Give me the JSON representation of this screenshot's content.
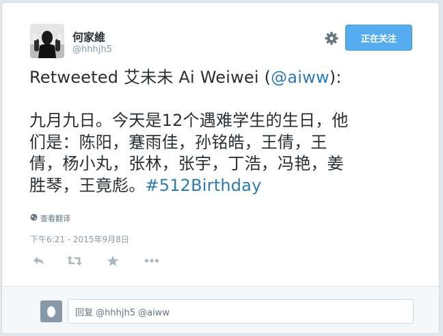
{
  "author": {
    "display_name": "何家維",
    "screen_name": "@hhhjh5"
  },
  "header": {
    "follow_button_label": "正在关注"
  },
  "tweet": {
    "retweet_prefix": "Retweeted 艾未未  Ai Weiwei (",
    "mention": "@aiww",
    "retweet_suffix": "):",
    "line1": "九月九日。今天是12个遇难学生的生日，他",
    "line2": "们是：陈阳，蹇雨佳，孙铭皓，王倩，王",
    "line3": "倩，杨小丸，张林，张宇，丁浩，冯艳，姜",
    "line4_text": "胜琴，王竟彪。",
    "hashtag": "#512Birthday"
  },
  "translate_label": "查看翻译",
  "timestamp": "下午6:21 - 2015年9月8日",
  "actions": [
    "reply-icon",
    "retweet-icon",
    "favorite-icon",
    "more-icon"
  ],
  "reply": {
    "placeholder": "回复 @hhhjh5 @aiww"
  },
  "colors": {
    "link": "#2b7bb9",
    "follow_button": "#55acee",
    "background": "#e1e8ed"
  }
}
